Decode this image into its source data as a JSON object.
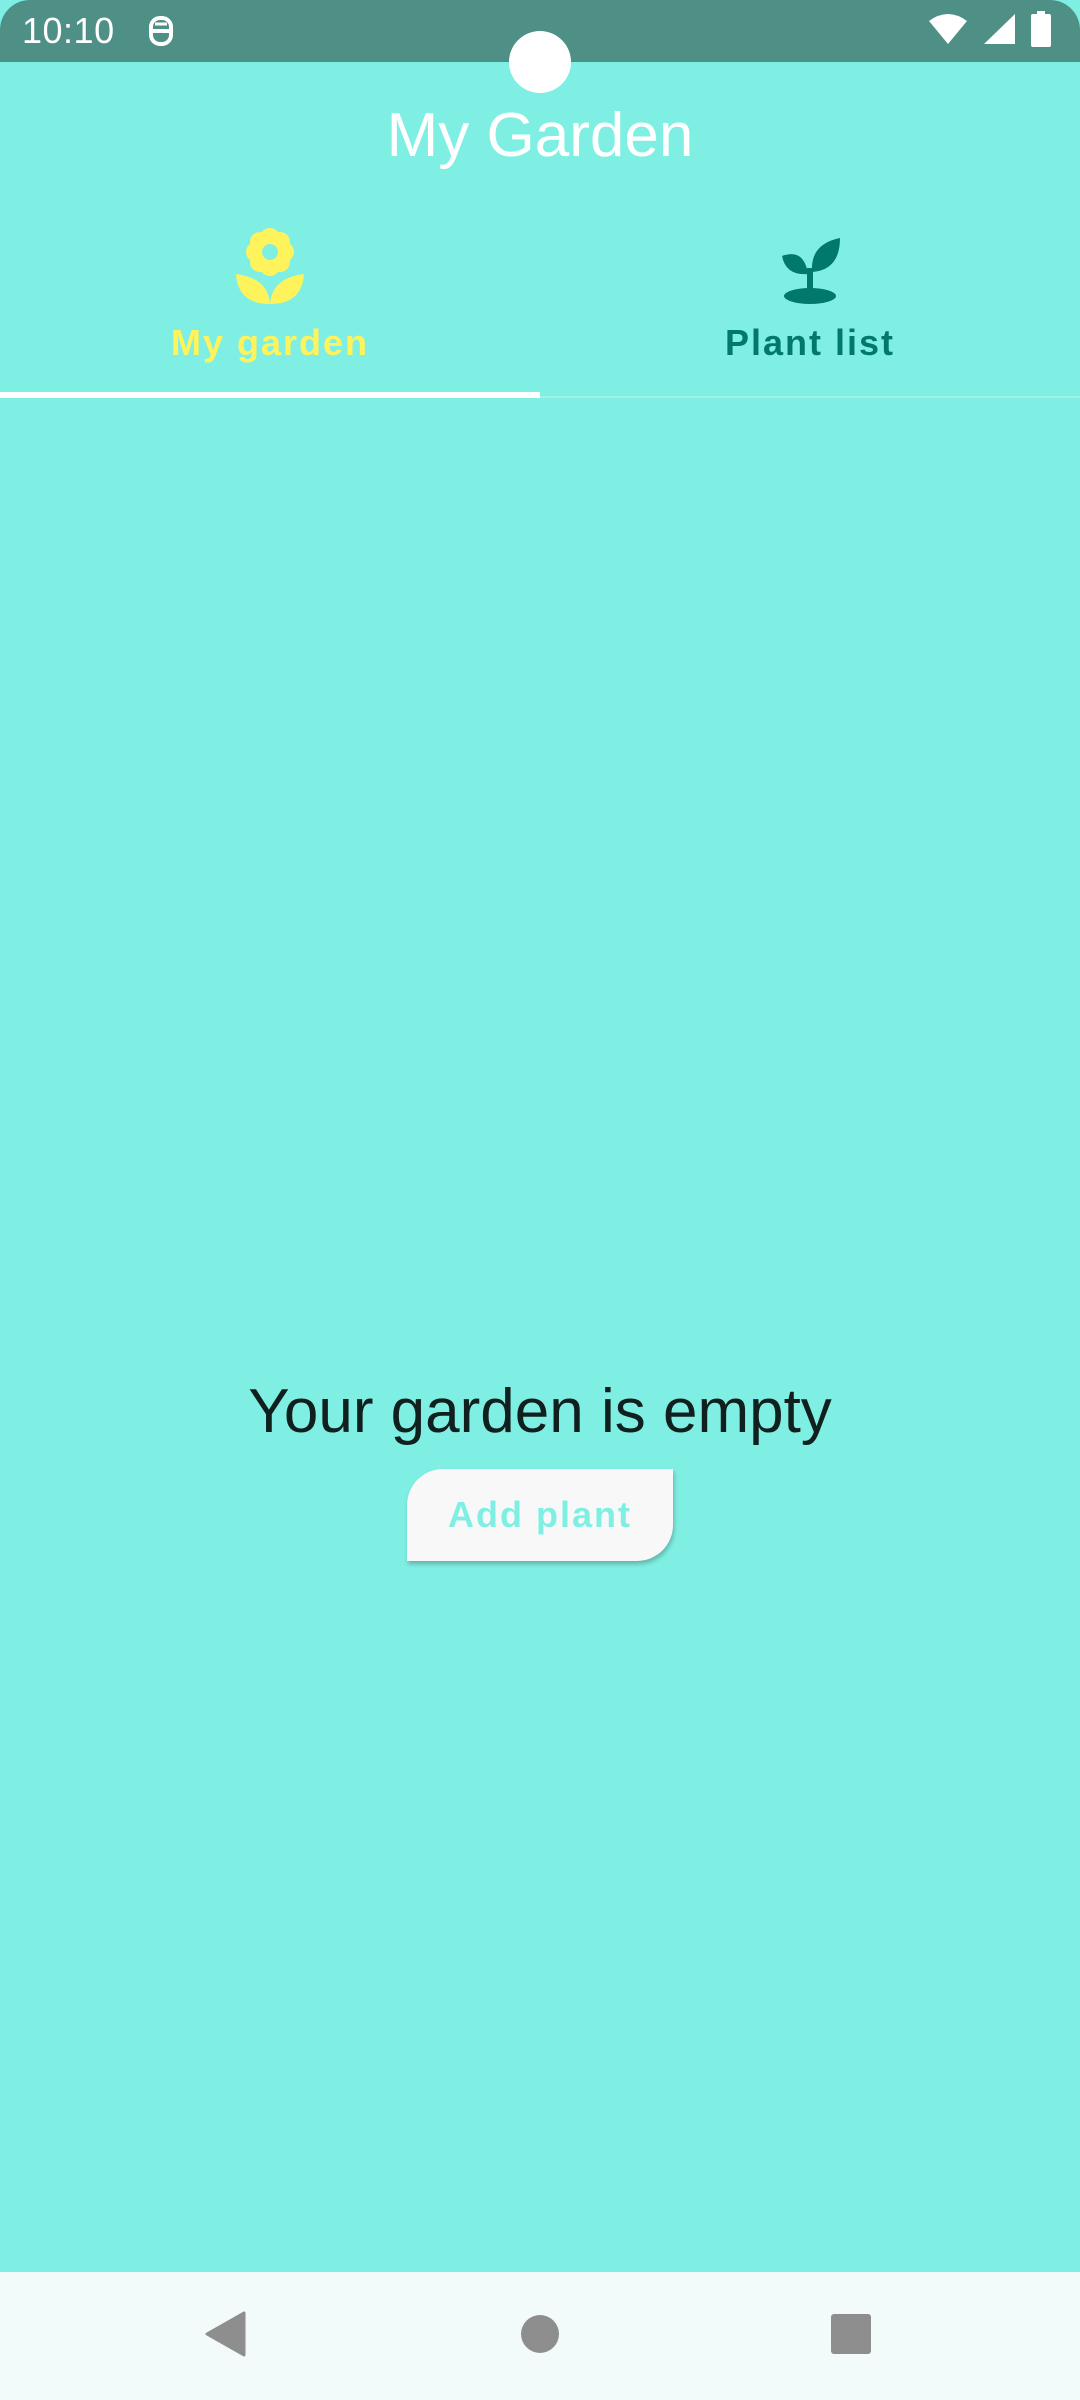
{
  "status_bar": {
    "time": "10:10",
    "icons": [
      "app-notification-icon",
      "wifi-icon",
      "cellular-signal-icon",
      "battery-icon"
    ]
  },
  "toolbar": {
    "title": "My Garden"
  },
  "tabs": [
    {
      "label": "My garden",
      "icon": "flower-icon",
      "selected": true,
      "color": "#FFF35C"
    },
    {
      "label": "Plant list",
      "icon": "sprout-icon",
      "selected": false,
      "color": "#00796B"
    }
  ],
  "empty_state": {
    "message": "Your garden is empty",
    "button_label": "Add plant"
  },
  "navigation_bar": {
    "buttons": [
      "back-icon",
      "home-icon",
      "recents-icon"
    ]
  },
  "colors": {
    "background": "#80EFE3",
    "status_bar": "#4E8F86",
    "accent_selected": "#FFF35C",
    "accent_unselected": "#00796B",
    "button_background": "#F8F8F8"
  }
}
